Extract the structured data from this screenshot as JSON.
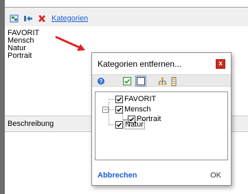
{
  "host": {
    "toolbar": {
      "categories_link": "Kategorien",
      "icons": [
        "edit-icon",
        "move-icon",
        "delete-icon"
      ]
    },
    "category_list": [
      "FAVORIT",
      "Mensch",
      "Natur",
      "Portrait"
    ],
    "description_label": "Beschreibung"
  },
  "dialog": {
    "title": "Kategorien entfernen...",
    "close_label": "x",
    "toolbar_icons": [
      "help-icon",
      "check-all-icon",
      "uncheck-all-icon",
      "tree-icon",
      "list-icon"
    ],
    "tree": [
      {
        "label": "FAVORIT",
        "checked": true,
        "level": 0
      },
      {
        "label": "Mensch",
        "checked": true,
        "level": 0,
        "expanded": true
      },
      {
        "label": "Portrait",
        "checked": true,
        "level": 1
      },
      {
        "label": "Natur",
        "checked": true,
        "level": 0,
        "focused": true
      }
    ],
    "cancel_label": "Abbrechen",
    "ok_label": "OK"
  },
  "colors": {
    "link_blue": "#1a5fd6",
    "close_red": "#c42b1c",
    "arrow_red": "#e02020"
  }
}
